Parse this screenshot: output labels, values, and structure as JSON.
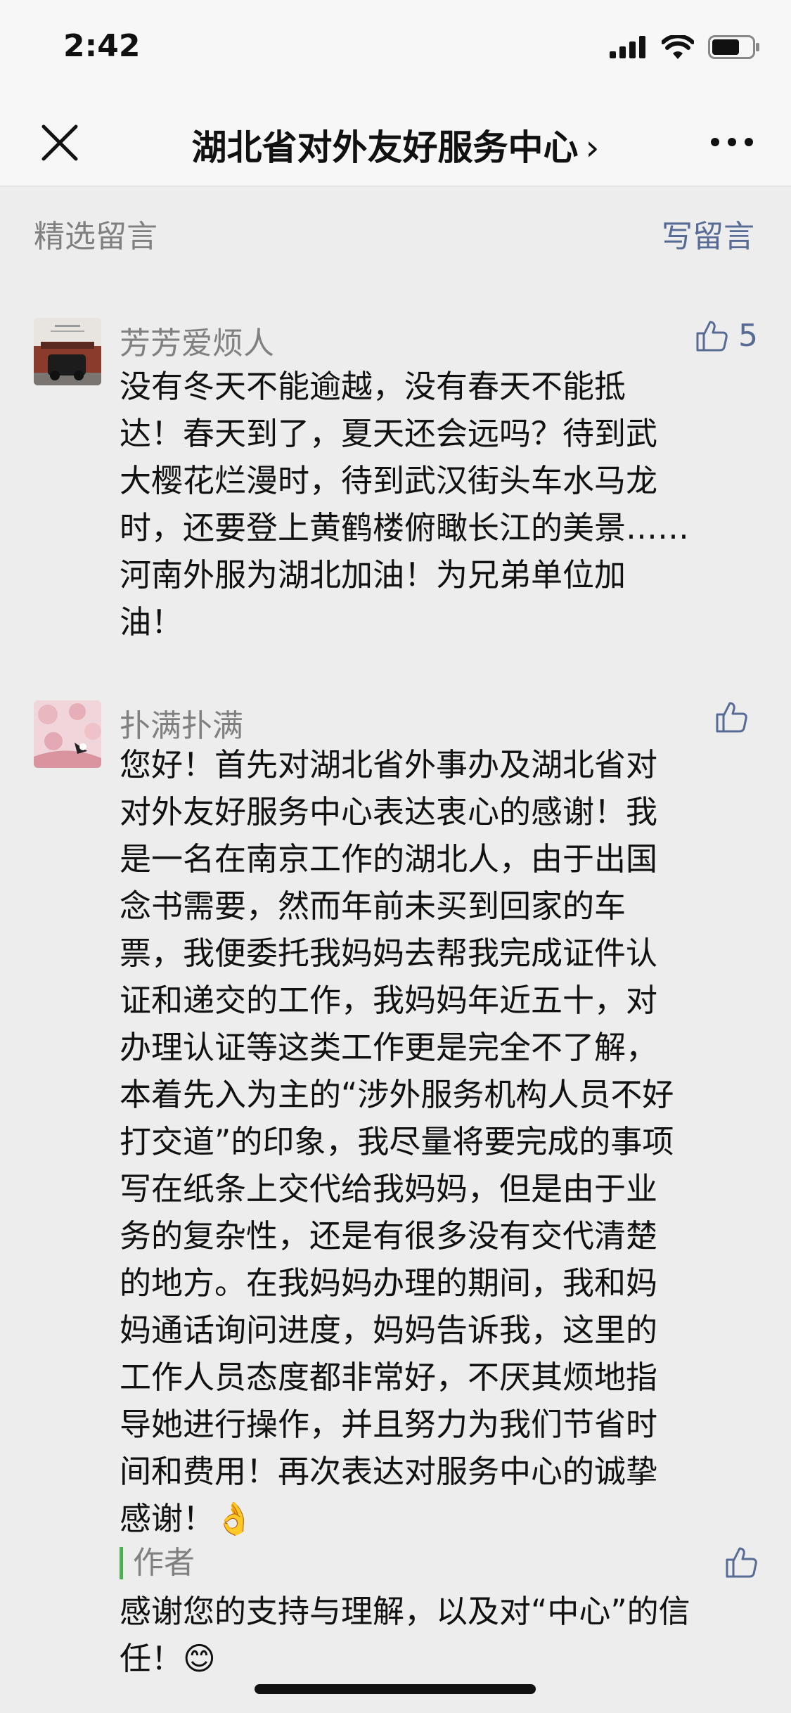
{
  "status_bar": {
    "time": "2:42"
  },
  "nav": {
    "title": "湖北省对外友好服务中心",
    "chevron": "›"
  },
  "section": {
    "label": "精选留言",
    "write": "写留言"
  },
  "comments": [
    {
      "author": "芳芳爱烦人",
      "likes": "5",
      "lines": [
        "没有冬天不能逾越，没有春天不能抵",
        "达！春天到了，夏天还会远吗？待到武",
        "大樱花烂漫时，待到武汉街头车水马龙",
        "时，还要登上黄鹤楼俯瞰长江的美景……",
        "河南外服为湖北加油！为兄弟单位加",
        "油！"
      ]
    },
    {
      "author": "扑满扑满",
      "likes": "",
      "lines": [
        "您好！首先对湖北省外事办及湖北省对",
        "对外友好服务中心表达衷心的感谢！我",
        "是一名在南京工作的湖北人，由于出国",
        "念书需要，然而年前未买到回家的车",
        "票，我便委托我妈妈去帮我完成证件认",
        "证和递交的工作，我妈妈年近五十，对",
        "办理认证等这类工作更是完全不了解，",
        "本着先入为主的“涉外服务机构人员不好",
        "打交道”的印象，我尽量将要完成的事项",
        "写在纸条上交代给我妈妈，但是由于业",
        "务的复杂性，还是有很多没有交代清楚",
        "的地方。在我妈妈办理的期间，我和妈",
        "妈通话询问进度，妈妈告诉我，这里的",
        "工作人员态度都非常好，不厌其烦地指",
        "导她进行操作，并且努力为我们节省时",
        "间和费用！再次表达对服务中心的诚挚",
        "感谢！👌"
      ],
      "reply": {
        "author": "作者",
        "lines": [
          "感谢您的支持与理解，以及对“中心”的信",
          "任！😊"
        ]
      }
    }
  ]
}
